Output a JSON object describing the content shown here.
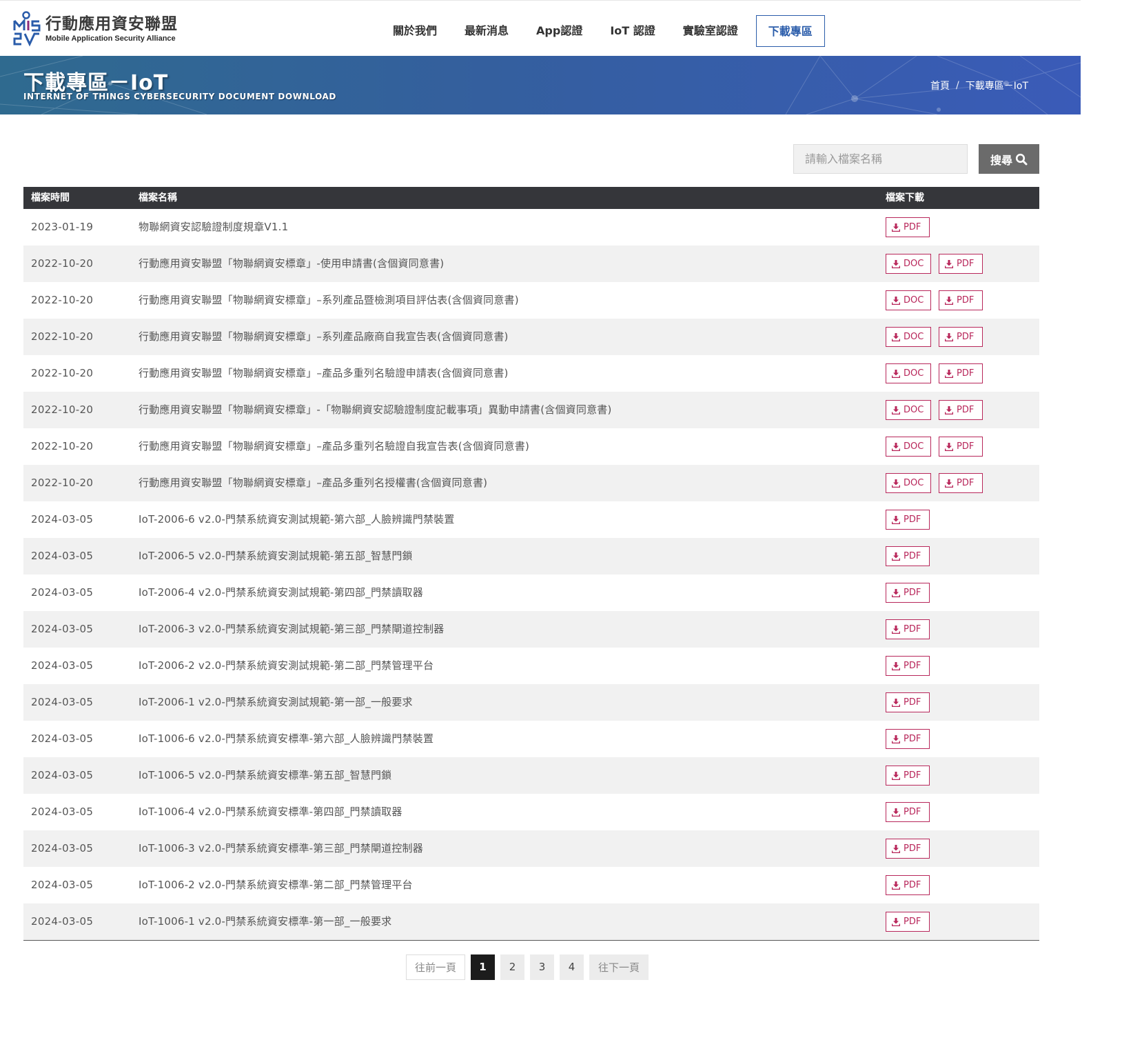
{
  "brand": {
    "name_cn": "行動應用資安聯盟",
    "name_en": "Mobile Application Security Alliance",
    "logo_colors": [
      "#2a5caa",
      "#8a2a7a"
    ]
  },
  "nav": {
    "items": [
      {
        "label": "關於我們"
      },
      {
        "label": "最新消息"
      },
      {
        "label": "App認證"
      },
      {
        "label": "IoT 認證"
      },
      {
        "label": "實驗室認證"
      },
      {
        "label": "下載專區",
        "active": true
      }
    ]
  },
  "banner": {
    "title": "下載專區－IoT",
    "subtitle": "INTERNET OF THINGS CYBERSECURITY DOCUMENT DOWNLOAD",
    "breadcrumb": {
      "home": "首頁",
      "separator": "/",
      "current": "下載專區－IoT"
    }
  },
  "search": {
    "placeholder": "請輸入檔案名稱",
    "value": "",
    "button_label": "搜尋",
    "button_icon": "magnifier-icon"
  },
  "table": {
    "headers": {
      "date": "檔案時間",
      "name": "檔案名稱",
      "download": "檔案下載"
    },
    "accent_color": "#b8265a",
    "rows": [
      {
        "date": "2023-01-19",
        "name": "物聯網資安認驗證制度規章V1.1",
        "files": [
          "PDF"
        ]
      },
      {
        "date": "2022-10-20",
        "name": "行動應用資安聯盟「物聯網資安標章」-使用申請書(含個資同意書)",
        "files": [
          "DOC",
          "PDF"
        ]
      },
      {
        "date": "2022-10-20",
        "name": "行動應用資安聯盟「物聯網資安標章」–系列產品暨檢測項目評估表(含個資同意書)",
        "files": [
          "DOC",
          "PDF"
        ]
      },
      {
        "date": "2022-10-20",
        "name": "行動應用資安聯盟「物聯網資安標章」–系列產品廠商自我宣告表(含個資同意書)",
        "files": [
          "DOC",
          "PDF"
        ]
      },
      {
        "date": "2022-10-20",
        "name": "行動應用資安聯盟「物聯網資安標章」–產品多重列名驗證申請表(含個資同意書)",
        "files": [
          "DOC",
          "PDF"
        ]
      },
      {
        "date": "2022-10-20",
        "name": "行動應用資安聯盟「物聯網資安標章」-「物聯網資安認驗證制度記載事項」異動申請書(含個資同意書)",
        "files": [
          "DOC",
          "PDF"
        ]
      },
      {
        "date": "2022-10-20",
        "name": "行動應用資安聯盟「物聯網資安標章」–產品多重列名驗證自我宣告表(含個資同意書)",
        "files": [
          "DOC",
          "PDF"
        ]
      },
      {
        "date": "2022-10-20",
        "name": "行動應用資安聯盟「物聯網資安標章」–產品多重列名授權書(含個資同意書)",
        "files": [
          "DOC",
          "PDF"
        ]
      },
      {
        "date": "2024-03-05",
        "name": "IoT-2006-6 v2.0-門禁系統資安測試規範-第六部_人臉辨識門禁裝置",
        "files": [
          "PDF"
        ]
      },
      {
        "date": "2024-03-05",
        "name": "IoT-2006-5 v2.0-門禁系統資安測試規範-第五部_智慧門鎖",
        "files": [
          "PDF"
        ]
      },
      {
        "date": "2024-03-05",
        "name": "IoT-2006-4 v2.0-門禁系統資安測試規範-第四部_門禁讀取器",
        "files": [
          "PDF"
        ]
      },
      {
        "date": "2024-03-05",
        "name": "IoT-2006-3 v2.0-門禁系統資安測試規範-第三部_門禁閘道控制器",
        "files": [
          "PDF"
        ]
      },
      {
        "date": "2024-03-05",
        "name": "IoT-2006-2 v2.0-門禁系統資安測試規範-第二部_門禁管理平台",
        "files": [
          "PDF"
        ]
      },
      {
        "date": "2024-03-05",
        "name": "IoT-2006-1 v2.0-門禁系統資安測試規範-第一部_一般要求",
        "files": [
          "PDF"
        ]
      },
      {
        "date": "2024-03-05",
        "name": "IoT-1006-6 v2.0-門禁系統資安標準-第六部_人臉辨識門禁裝置",
        "files": [
          "PDF"
        ]
      },
      {
        "date": "2024-03-05",
        "name": "IoT-1006-5 v2.0-門禁系統資安標準-第五部_智慧門鎖",
        "files": [
          "PDF"
        ]
      },
      {
        "date": "2024-03-05",
        "name": "IoT-1006-4 v2.0-門禁系統資安標準-第四部_門禁讀取器",
        "files": [
          "PDF"
        ]
      },
      {
        "date": "2024-03-05",
        "name": "IoT-1006-3 v2.0-門禁系統資安標準-第三部_門禁閘道控制器",
        "files": [
          "PDF"
        ]
      },
      {
        "date": "2024-03-05",
        "name": "IoT-1006-2 v2.0-門禁系統資安標準-第二部_門禁管理平台",
        "files": [
          "PDF"
        ]
      },
      {
        "date": "2024-03-05",
        "name": "IoT-1006-1 v2.0-門禁系統資安標準-第一部_一般要求",
        "files": [
          "PDF"
        ]
      }
    ]
  },
  "pagination": {
    "prev_label": "往前一頁",
    "next_label": "往下一頁",
    "pages": [
      "1",
      "2",
      "3",
      "4"
    ],
    "current": "1"
  }
}
